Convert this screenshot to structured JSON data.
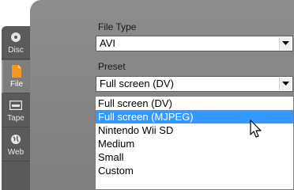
{
  "sidebar": {
    "tabs": [
      {
        "label": "Disc",
        "icon": "disc-icon"
      },
      {
        "label": "File",
        "icon": "file-icon"
      },
      {
        "label": "Tape",
        "icon": "tape-icon"
      },
      {
        "label": "Web",
        "icon": "web-icon"
      }
    ],
    "active": "File"
  },
  "file_type": {
    "label": "File Type",
    "value": "AVI"
  },
  "preset": {
    "label": "Preset",
    "value": "Full screen (DV)",
    "options": [
      "Full screen (DV)",
      "Full screen (MJPEG)",
      "Nintendo Wii SD",
      "Medium",
      "Small",
      "Custom"
    ],
    "highlighted": "Full screen (MJPEG)"
  },
  "colors": {
    "highlight": "#3399ff",
    "panel": "#868686",
    "sidebar": "#5a5a5a"
  }
}
